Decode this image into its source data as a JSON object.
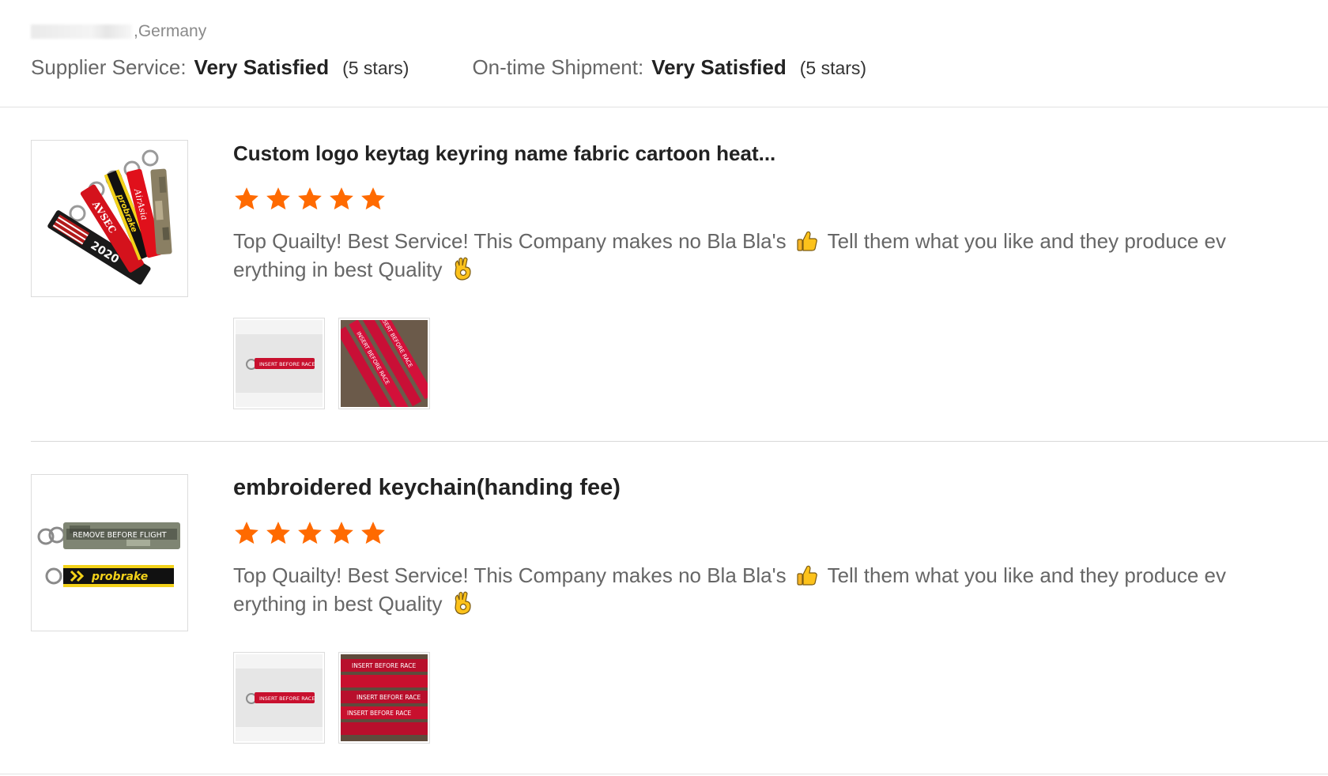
{
  "reviewer": {
    "country": ",Germany"
  },
  "ratings": {
    "supplier_service": {
      "label": "Supplier Service:",
      "value": "Very Satisfied",
      "stars_text": "(5 stars)"
    },
    "on_time_shipment": {
      "label": "On-time Shipment:",
      "value": "Very Satisfied",
      "stars_text": "(5 stars)"
    }
  },
  "reviews": [
    {
      "product_title": "Custom logo keytag keyring name fabric cartoon heat...",
      "rating": 5,
      "text_before_emoji": "Top Quailty! Best Service! This Company makes no Bla Bla's",
      "text_after_emoji": "Tell them what you like and they produce ev erything in best Quality",
      "photo_count": 2
    },
    {
      "product_title": "embroidered keychain(handing fee)",
      "rating": 5,
      "text_before_emoji": "Top Quailty! Best Service! This Company makes no Bla Bla's",
      "text_after_emoji": "Tell them what you like and they produce ev erything in best Quality",
      "photo_count": 2
    }
  ],
  "images": {
    "product_1_tags": [
      "AVSEC",
      "2020",
      "probrake",
      "AirAsia"
    ],
    "product_2_tags": [
      "REMOVE BEFORE FLIGHT",
      "probrake"
    ],
    "photo_tag_text": "INSERT BEFORE RACE"
  },
  "colors": {
    "star": "#ff6a00",
    "text_primary": "#222222",
    "text_secondary": "#666666",
    "border": "#dcdcdc"
  },
  "icons": {
    "rating_star": "star-icon",
    "thumbs_up": "thumbs-up-emoji",
    "ok_hand": "ok-hand-emoji"
  }
}
